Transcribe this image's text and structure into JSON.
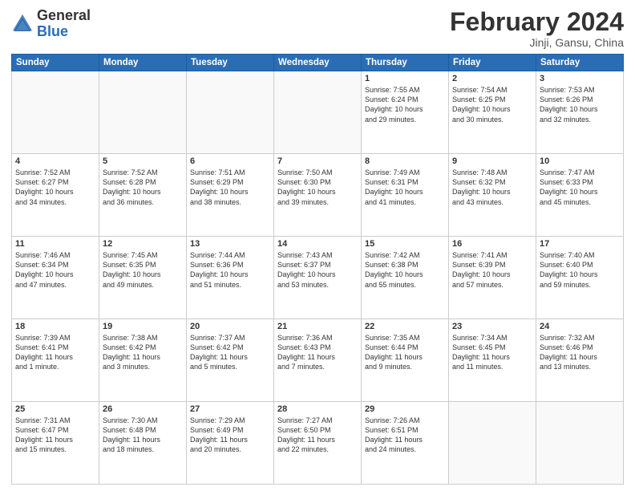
{
  "logo": {
    "general": "General",
    "blue": "Blue"
  },
  "title": "February 2024",
  "subtitle": "Jinji, Gansu, China",
  "days_of_week": [
    "Sunday",
    "Monday",
    "Tuesday",
    "Wednesday",
    "Thursday",
    "Friday",
    "Saturday"
  ],
  "weeks": [
    [
      {
        "day": "",
        "info": ""
      },
      {
        "day": "",
        "info": ""
      },
      {
        "day": "",
        "info": ""
      },
      {
        "day": "",
        "info": ""
      },
      {
        "day": "1",
        "info": "Sunrise: 7:55 AM\nSunset: 6:24 PM\nDaylight: 10 hours\nand 29 minutes."
      },
      {
        "day": "2",
        "info": "Sunrise: 7:54 AM\nSunset: 6:25 PM\nDaylight: 10 hours\nand 30 minutes."
      },
      {
        "day": "3",
        "info": "Sunrise: 7:53 AM\nSunset: 6:26 PM\nDaylight: 10 hours\nand 32 minutes."
      }
    ],
    [
      {
        "day": "4",
        "info": "Sunrise: 7:52 AM\nSunset: 6:27 PM\nDaylight: 10 hours\nand 34 minutes."
      },
      {
        "day": "5",
        "info": "Sunrise: 7:52 AM\nSunset: 6:28 PM\nDaylight: 10 hours\nand 36 minutes."
      },
      {
        "day": "6",
        "info": "Sunrise: 7:51 AM\nSunset: 6:29 PM\nDaylight: 10 hours\nand 38 minutes."
      },
      {
        "day": "7",
        "info": "Sunrise: 7:50 AM\nSunset: 6:30 PM\nDaylight: 10 hours\nand 39 minutes."
      },
      {
        "day": "8",
        "info": "Sunrise: 7:49 AM\nSunset: 6:31 PM\nDaylight: 10 hours\nand 41 minutes."
      },
      {
        "day": "9",
        "info": "Sunrise: 7:48 AM\nSunset: 6:32 PM\nDaylight: 10 hours\nand 43 minutes."
      },
      {
        "day": "10",
        "info": "Sunrise: 7:47 AM\nSunset: 6:33 PM\nDaylight: 10 hours\nand 45 minutes."
      }
    ],
    [
      {
        "day": "11",
        "info": "Sunrise: 7:46 AM\nSunset: 6:34 PM\nDaylight: 10 hours\nand 47 minutes."
      },
      {
        "day": "12",
        "info": "Sunrise: 7:45 AM\nSunset: 6:35 PM\nDaylight: 10 hours\nand 49 minutes."
      },
      {
        "day": "13",
        "info": "Sunrise: 7:44 AM\nSunset: 6:36 PM\nDaylight: 10 hours\nand 51 minutes."
      },
      {
        "day": "14",
        "info": "Sunrise: 7:43 AM\nSunset: 6:37 PM\nDaylight: 10 hours\nand 53 minutes."
      },
      {
        "day": "15",
        "info": "Sunrise: 7:42 AM\nSunset: 6:38 PM\nDaylight: 10 hours\nand 55 minutes."
      },
      {
        "day": "16",
        "info": "Sunrise: 7:41 AM\nSunset: 6:39 PM\nDaylight: 10 hours\nand 57 minutes."
      },
      {
        "day": "17",
        "info": "Sunrise: 7:40 AM\nSunset: 6:40 PM\nDaylight: 10 hours\nand 59 minutes."
      }
    ],
    [
      {
        "day": "18",
        "info": "Sunrise: 7:39 AM\nSunset: 6:41 PM\nDaylight: 11 hours\nand 1 minute."
      },
      {
        "day": "19",
        "info": "Sunrise: 7:38 AM\nSunset: 6:42 PM\nDaylight: 11 hours\nand 3 minutes."
      },
      {
        "day": "20",
        "info": "Sunrise: 7:37 AM\nSunset: 6:42 PM\nDaylight: 11 hours\nand 5 minutes."
      },
      {
        "day": "21",
        "info": "Sunrise: 7:36 AM\nSunset: 6:43 PM\nDaylight: 11 hours\nand 7 minutes."
      },
      {
        "day": "22",
        "info": "Sunrise: 7:35 AM\nSunset: 6:44 PM\nDaylight: 11 hours\nand 9 minutes."
      },
      {
        "day": "23",
        "info": "Sunrise: 7:34 AM\nSunset: 6:45 PM\nDaylight: 11 hours\nand 11 minutes."
      },
      {
        "day": "24",
        "info": "Sunrise: 7:32 AM\nSunset: 6:46 PM\nDaylight: 11 hours\nand 13 minutes."
      }
    ],
    [
      {
        "day": "25",
        "info": "Sunrise: 7:31 AM\nSunset: 6:47 PM\nDaylight: 11 hours\nand 15 minutes."
      },
      {
        "day": "26",
        "info": "Sunrise: 7:30 AM\nSunset: 6:48 PM\nDaylight: 11 hours\nand 18 minutes."
      },
      {
        "day": "27",
        "info": "Sunrise: 7:29 AM\nSunset: 6:49 PM\nDaylight: 11 hours\nand 20 minutes."
      },
      {
        "day": "28",
        "info": "Sunrise: 7:27 AM\nSunset: 6:50 PM\nDaylight: 11 hours\nand 22 minutes."
      },
      {
        "day": "29",
        "info": "Sunrise: 7:26 AM\nSunset: 6:51 PM\nDaylight: 11 hours\nand 24 minutes."
      },
      {
        "day": "",
        "info": ""
      },
      {
        "day": "",
        "info": ""
      }
    ]
  ]
}
